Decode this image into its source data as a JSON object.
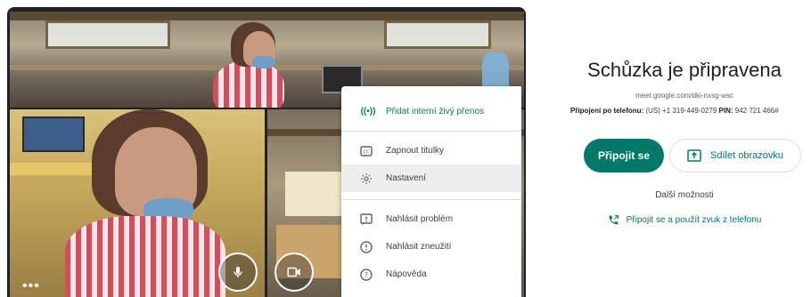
{
  "menu": {
    "items": [
      {
        "label": "Přidat interní živý přenos",
        "icon": "live-stream-icon"
      },
      {
        "label": "Zapnout titulky",
        "icon": "captions-icon"
      },
      {
        "label": "Nastavení",
        "icon": "settings-gear-icon"
      },
      {
        "label": "Nahlásit problém",
        "icon": "report-problem-icon"
      },
      {
        "label": "Nahlásit zneužití",
        "icon": "report-abuse-icon"
      },
      {
        "label": "Nápověda",
        "icon": "help-icon"
      }
    ],
    "live_glyph": "((•))"
  },
  "preview": {
    "more_glyph": "•••"
  },
  "meeting": {
    "title": "Schůzka je připravena",
    "url": "meet.google.com/dki-nxsg-wsc",
    "phone_label": "Připojení po telefonu:",
    "phone_number": "(US) +1 319-449-0279",
    "pin_label": "PIN:",
    "pin_value": "942 721 466#",
    "join_label": "Připojit se",
    "share_label": "Sdílet obrazovku",
    "more_options": "Další možnosti",
    "phone_join_label": "Připojit se a použít zvuk z telefonu"
  },
  "colors": {
    "accent": "#00796b",
    "menu_live": "#0f7a5c"
  }
}
